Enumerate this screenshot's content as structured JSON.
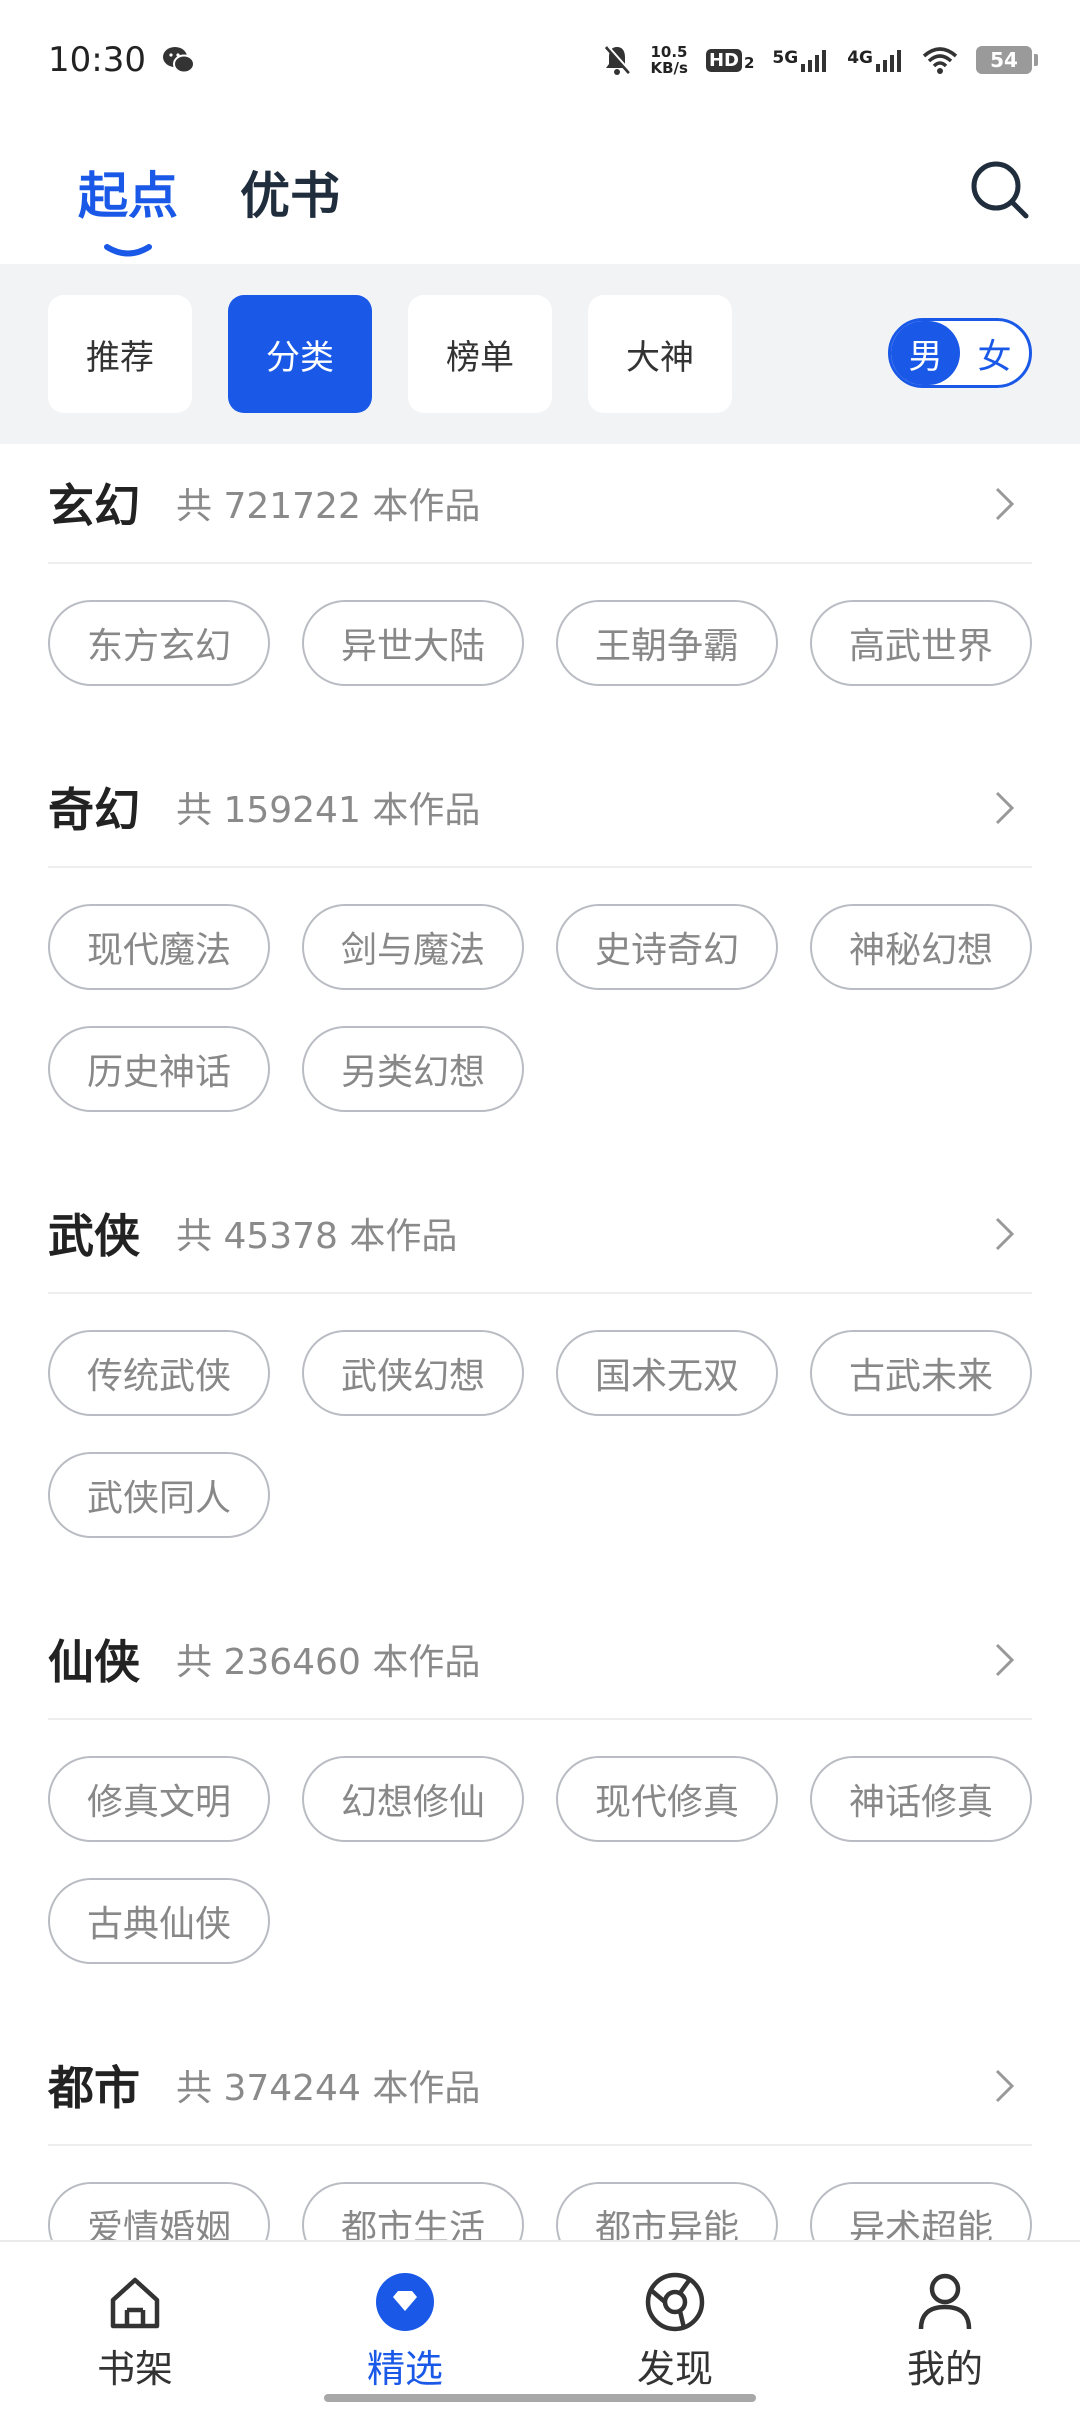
{
  "status": {
    "time": "10:30",
    "net_speed_value": "10.5",
    "net_speed_unit": "KB/s",
    "hd": "HD",
    "hd_sub": "2",
    "sig1": "5G",
    "sig2": "4G",
    "battery": "54"
  },
  "top_tabs": [
    {
      "label": "起点",
      "active": true
    },
    {
      "label": "优书",
      "active": false
    }
  ],
  "filters": [
    {
      "label": "推荐"
    },
    {
      "label": "分类"
    },
    {
      "label": "榜单"
    },
    {
      "label": "大神"
    }
  ],
  "gender": {
    "male": "男",
    "female": "女"
  },
  "categories": [
    {
      "name": "玄幻",
      "count": "共 721722 本作品",
      "tags": [
        "东方玄幻",
        "异世大陆",
        "王朝争霸",
        "高武世界"
      ]
    },
    {
      "name": "奇幻",
      "count": "共 159241 本作品",
      "tags": [
        "现代魔法",
        "剑与魔法",
        "史诗奇幻",
        "神秘幻想",
        "历史神话",
        "另类幻想"
      ]
    },
    {
      "name": "武侠",
      "count": "共 45378 本作品",
      "tags": [
        "传统武侠",
        "武侠幻想",
        "国术无双",
        "古武未来",
        "武侠同人"
      ]
    },
    {
      "name": "仙侠",
      "count": "共 236460 本作品",
      "tags": [
        "修真文明",
        "幻想修仙",
        "现代修真",
        "神话修真",
        "古典仙侠"
      ]
    },
    {
      "name": "都市",
      "count": "共 374244 本作品",
      "tags": [
        "爱情婚姻",
        "都市生活",
        "都市异能",
        "异术超能"
      ]
    }
  ],
  "bottom_nav": [
    {
      "label": "书架"
    },
    {
      "label": "精选"
    },
    {
      "label": "发现"
    },
    {
      "label": "我的"
    }
  ],
  "colors": {
    "accent": "#1a59e8",
    "tag_border": "#b9bcc2",
    "filter_bg": "#f1f3f5"
  }
}
